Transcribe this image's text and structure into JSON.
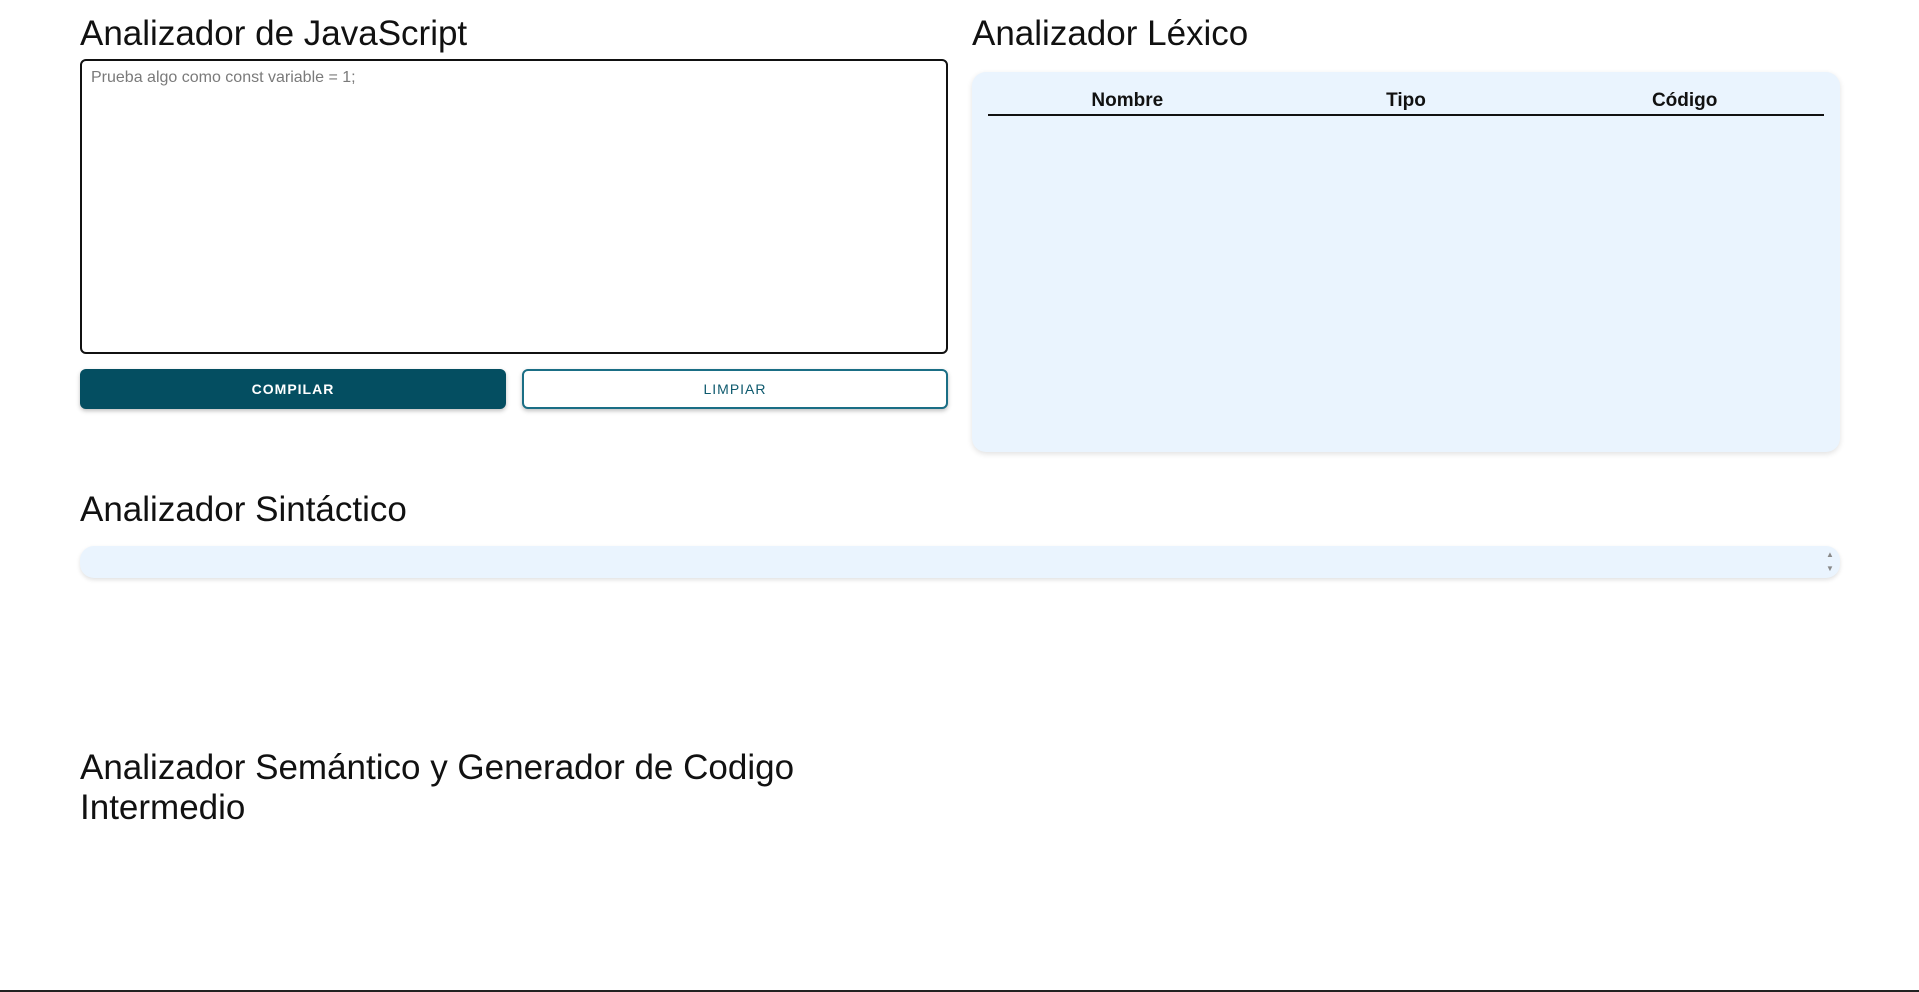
{
  "editor_section": {
    "title": "Analizador de JavaScript",
    "placeholder": "Prueba algo como const variable = 1;",
    "value": "",
    "compile_label": "COMPILAR",
    "clear_label": "LIMPIAR"
  },
  "lexical_section": {
    "title": "Analizador Léxico",
    "columns": [
      "Nombre",
      "Tipo",
      "Código"
    ]
  },
  "syntactic_section": {
    "title": "Analizador Sintáctico"
  },
  "semantic_section": {
    "title": "Analizador Semántico y Generador de Codigo Intermedio"
  },
  "colors": {
    "primary": "#044e61",
    "panel": "#eaf4fe"
  },
  "icons": {
    "spinner_up": "spinner-up-icon",
    "spinner_down": "spinner-down-icon"
  }
}
